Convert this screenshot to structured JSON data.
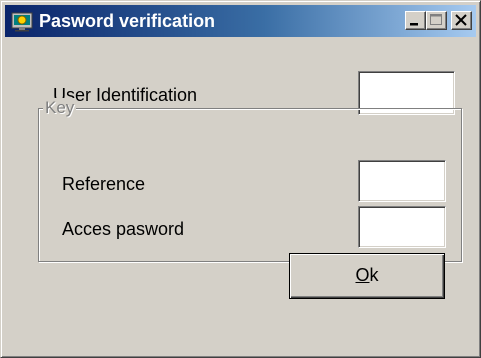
{
  "window": {
    "title": "Pasword verification",
    "title_gradient_start": "#0a246a",
    "title_gradient_end": "#a6caf0",
    "face_color": "#d4d0c8",
    "icon": "app-icon"
  },
  "caption_buttons": {
    "minimize_icon": "minimize-icon",
    "maximize_icon": "maximize-icon",
    "close_icon": "close-icon"
  },
  "form": {
    "user_id_label": "User Identification",
    "user_id_value": "",
    "key_group_caption": "Key",
    "reference_label": "Reference",
    "reference_value": "",
    "password_label": "Acces pasword",
    "password_value": ""
  },
  "ok_button": {
    "accel": "O",
    "rest": "k"
  }
}
